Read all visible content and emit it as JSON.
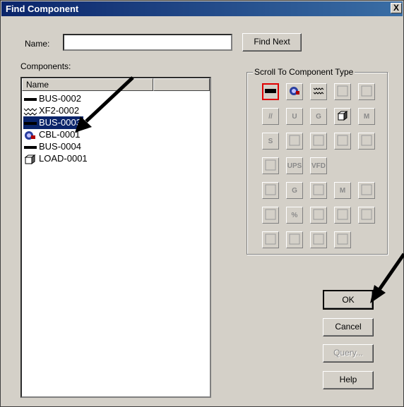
{
  "window": {
    "title": "Find Component",
    "close_glyph": "X"
  },
  "name_field": {
    "label": "Name:",
    "value": ""
  },
  "buttons": {
    "find_next": "Find Next",
    "ok": "OK",
    "cancel": "Cancel",
    "query": "Query...",
    "help": "Help"
  },
  "components": {
    "label": "Components:",
    "column": "Name",
    "items": [
      {
        "label": "BUS-0002",
        "icon": "bus-icon",
        "selected": false
      },
      {
        "label": "XF2-0002",
        "icon": "transformer-icon",
        "selected": false
      },
      {
        "label": "BUS-0003",
        "icon": "bus-icon",
        "selected": true
      },
      {
        "label": "CBL-0001",
        "icon": "cable-icon",
        "selected": false
      },
      {
        "label": "BUS-0004",
        "icon": "bus-icon",
        "selected": false
      },
      {
        "label": "LOAD-0001",
        "icon": "load-icon",
        "selected": false
      }
    ]
  },
  "scroll_group": {
    "label": "Scroll To Component Type",
    "selected_type": "bus",
    "types": [
      [
        "bus",
        "cable",
        "transformer-2w",
        "transformer-3w",
        "transformer-winding"
      ],
      [
        "impedance",
        "utility",
        "generator",
        "load",
        "motor"
      ],
      [
        "static-source",
        "switch",
        "panel",
        "transfer-switch",
        "busway"
      ],
      [
        "capacitor-bank",
        "ups",
        "vfd"
      ],
      [
        "breaker-panel",
        "capacitor",
        "filter",
        "motor-group",
        "load-group"
      ],
      [
        "charger",
        "inverter",
        "battery",
        "harmonic",
        "surge"
      ],
      [
        "schedule",
        "relay",
        "fuse",
        "meter"
      ]
    ],
    "type_glyphs": [
      "",
      "",
      "",
      "",
      "",
      "//",
      "U",
      "G",
      "",
      "M",
      "S",
      "",
      "",
      "",
      "",
      "",
      "UPS",
      "VFD",
      "",
      "G",
      "",
      "M",
      "",
      "",
      "%",
      "",
      "",
      "",
      "",
      "",
      "",
      ""
    ]
  }
}
